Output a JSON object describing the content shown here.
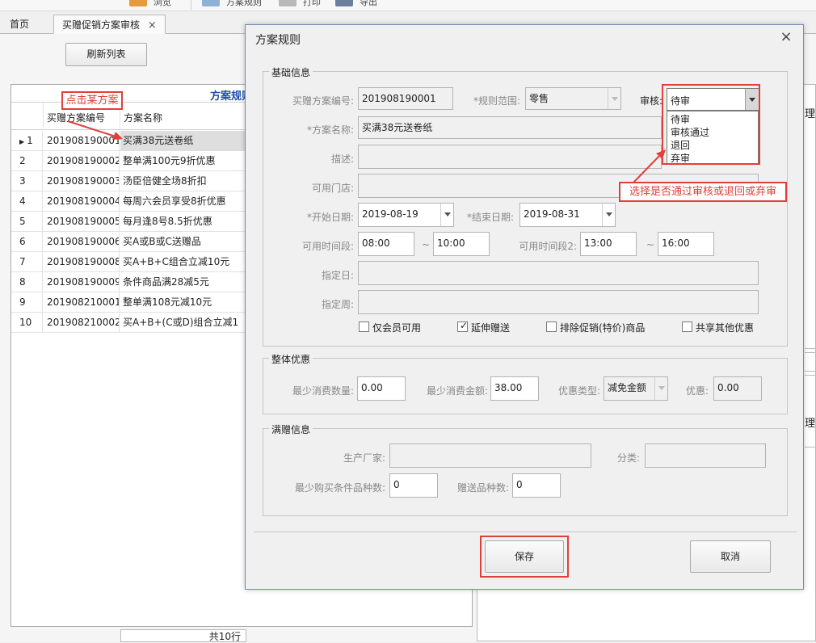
{
  "toolbar": {
    "items": [
      {
        "label": "浏览",
        "icon": "folder-icon"
      },
      {
        "label": "方案规则",
        "icon": "magnifier-icon"
      },
      {
        "label": "打印",
        "icon": "document-icon"
      },
      {
        "label": "导出",
        "icon": "save-icon"
      }
    ]
  },
  "tabs": [
    {
      "label": "首页"
    },
    {
      "label": "买赠促销方案审核",
      "close": "×"
    }
  ],
  "main": {
    "refresh_label": "刷新列表",
    "grid_title": "方案规则",
    "columns": [
      "买赠方案编号",
      "方案名称"
    ],
    "rows": [
      {
        "num": "1",
        "code": "201908190001",
        "name": "买满38元送卷纸"
      },
      {
        "num": "2",
        "code": "201908190002",
        "name": "整单满100元9折优惠"
      },
      {
        "num": "3",
        "code": "201908190003",
        "name": "汤臣倍健全场8折扣"
      },
      {
        "num": "4",
        "code": "201908190004",
        "name": "每周六会员享受8折优惠"
      },
      {
        "num": "5",
        "code": "201908190005",
        "name": "每月逢8号8.5折优惠"
      },
      {
        "num": "6",
        "code": "201908190006",
        "name": "买A或B或C送赠品"
      },
      {
        "num": "7",
        "code": "201908190008",
        "name": "买A+B+C组合立减10元"
      },
      {
        "num": "8",
        "code": "201908190009",
        "name": "条件商品满28减5元"
      },
      {
        "num": "9",
        "code": "201908210001",
        "name": "整单满108元减10元"
      },
      {
        "num": "10",
        "code": "201908210002",
        "name": "买A+B+(C或D)组合立减1"
      }
    ],
    "footer_count": "共10行",
    "right_header_1": "理",
    "right_header_2": "理"
  },
  "annotations": {
    "click_hint": "点击某方案",
    "select_hint": "选择是否通过审核或退回或弃审"
  },
  "dialog": {
    "title": "方案规则",
    "close": "×",
    "basic": {
      "title": "基础信息",
      "code_label": "买赠方案编号:",
      "code_value": "201908190001",
      "scope_label": "*规则范围:",
      "scope_value": "零售",
      "audit_label": "审核:",
      "audit_value": "待审",
      "audit_options": [
        "待审",
        "审核通过",
        "退回",
        "弃审"
      ],
      "name_label": "*方案名称:",
      "name_value": "买满38元送卷纸",
      "desc_label": "描述:",
      "desc_value": "",
      "store_label": "可用门店:",
      "store_value": "",
      "start_label": "*开始日期:",
      "start_value": "2019-08-19",
      "end_label": "*结束日期:",
      "end_value": "2019-08-31",
      "time1_label": "可用时间段:",
      "time1_from": "08:00",
      "time1_to": "10:00",
      "time2_label": "可用时间段2:",
      "time2_from": "13:00",
      "time2_to": "16:00",
      "dash": "~",
      "day_label": "指定日:",
      "day_value": "",
      "week_label": "指定周:",
      "week_value": "",
      "checks": [
        {
          "label": "仅会员可用",
          "checked": false
        },
        {
          "label": "延伸赠送",
          "checked": true
        },
        {
          "label": "排除促销(特价)商品",
          "checked": false
        },
        {
          "label": "共享其他优惠",
          "checked": false
        }
      ],
      "check_mark": "✓"
    },
    "overall": {
      "title": "整体优惠",
      "min_qty_label": "最少消费数量:",
      "min_qty_value": "0.00",
      "min_amt_label": "最少消费金额:",
      "min_amt_value": "38.00",
      "type_label": "优惠类型:",
      "type_value": "减免金额",
      "discount_label": "优惠:",
      "discount_value": "0.00"
    },
    "gift": {
      "title": "满赠信息",
      "maker_label": "生产厂家:",
      "maker_value": "",
      "category_label": "分类:",
      "category_value": "",
      "min_kinds_label": "最少购买条件品种数:",
      "min_kinds_value": "0",
      "gift_kinds_label": "赠送品种数:",
      "gift_kinds_value": "0"
    },
    "save_label": "保存",
    "cancel_label": "取消"
  },
  "colors": {
    "accent_red": "#e0403a",
    "title_blue": "#1f4fa3",
    "dialog_border": "#6f8fb6"
  }
}
